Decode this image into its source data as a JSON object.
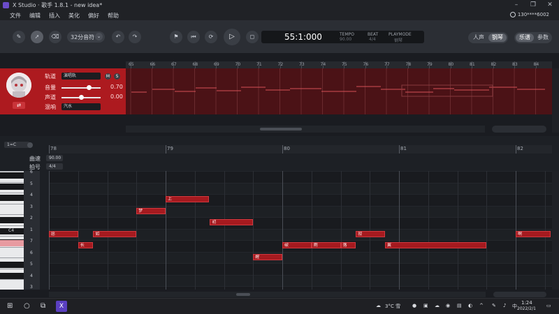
{
  "window": {
    "title": "X Studio · 歌手 1.8.1 - new idea*"
  },
  "menu": {
    "items": [
      "文件",
      "编辑",
      "插入",
      "美化",
      "偏好",
      "帮助"
    ],
    "user": "130****6002"
  },
  "toolbar": {
    "note_length": "32分音符",
    "time": "55:1:000",
    "tempo_label": "TEMPO",
    "tempo_value": "90.00",
    "beat_label": "BEAT",
    "beat_value": "4/4",
    "playmode_label": "PLAYMODE",
    "playmode_value": "钢琴",
    "mode_toggle": [
      "人声",
      "钢琴"
    ],
    "view_toggle": [
      "乐谱",
      "参数"
    ]
  },
  "track": {
    "name_label": "轨道",
    "name_value": "演唱轨",
    "volume_label": "音量",
    "volume_value": "0.70",
    "volume_level": 0.7,
    "pan_label": "声道",
    "pan_value": "0.00",
    "pan_level": 0.5,
    "reverb_label": "混响",
    "reverb_value": "汽水",
    "mute": "M",
    "solo": "S",
    "swap_icon": "⇄"
  },
  "overview": {
    "ruler": [
      "65",
      "66",
      "67",
      "68",
      "69",
      "70",
      "71",
      "72",
      "73",
      "74",
      "75",
      "76",
      "77",
      "78",
      "79",
      "80",
      "81",
      "82",
      "83",
      "84"
    ]
  },
  "editor": {
    "key_signature": "1=C",
    "tempo_label": "曲速",
    "tempo_value": "90.00",
    "beat_label": "拍号",
    "beat_value": "4/4",
    "ruler": [
      "78",
      "79",
      "80",
      "81",
      "82"
    ],
    "key_numbers": [
      "6",
      "5",
      "4",
      "3",
      "2",
      "1",
      "7",
      "6",
      "5",
      "4",
      "3"
    ],
    "c_label": "C4"
  },
  "notes": [
    {
      "lyric": "愿",
      "start": 78.0,
      "len": 0.25,
      "pitch": 1
    },
    {
      "lyric": "长",
      "start": 78.25,
      "len": 0.13,
      "pitch": 7
    },
    {
      "lyric": "如",
      "start": 78.38,
      "len": 0.37,
      "pitch": 1
    },
    {
      "lyric": "梦",
      "start": 78.75,
      "len": 0.25,
      "pitch": 3
    },
    {
      "lyric": "上",
      "start": 79.0,
      "len": 0.37,
      "pitch": 4
    },
    {
      "lyric": "初",
      "start": 79.38,
      "len": 0.37,
      "pitch": 2
    },
    {
      "lyric": "醒",
      "start": 79.75,
      "len": 0.25,
      "pitch": 6
    },
    {
      "lyric": "破",
      "start": 80.0,
      "len": 0.25,
      "pitch": 7
    },
    {
      "lyric": "雨",
      "start": 80.25,
      "len": 0.25,
      "pitch": 7
    },
    {
      "lyric": "落",
      "start": 80.5,
      "len": 0.13,
      "pitch": 7
    },
    {
      "lyric": "寂",
      "start": 80.63,
      "len": 0.25,
      "pitch": 1
    },
    {
      "lyric": "翼",
      "start": 80.88,
      "len": 0.87,
      "pitch": 7
    },
    {
      "lyric": "啊",
      "start": 82.0,
      "len": 0.3,
      "pitch": 1
    }
  ],
  "taskbar": {
    "weather": "3°C 雪",
    "time": "1:24",
    "date": "2022/2/1"
  }
}
